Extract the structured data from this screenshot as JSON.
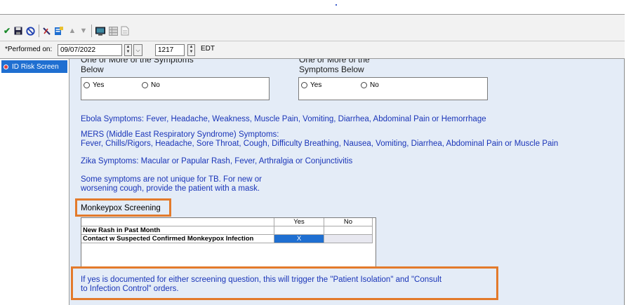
{
  "toolbar": {
    "icons": [
      "check-icon",
      "save-icon",
      "cancel-icon",
      "pen-icon",
      "form-icon",
      "up-arrow-icon",
      "down-arrow-icon",
      "monitor-icon",
      "grid-icon",
      "document-icon"
    ]
  },
  "performed": {
    "label": "*Performed on:",
    "date": "09/07/2022",
    "time": "1217",
    "timezone": "EDT"
  },
  "sidebar": {
    "items": [
      {
        "label": "ID Risk Screen"
      }
    ]
  },
  "form": {
    "q1": {
      "line1": "One or More of the Symptoms",
      "line2": "Below"
    },
    "q2": {
      "line1": "One or More of the",
      "line2": "Symptoms Below"
    },
    "yes": "Yes",
    "no": "No",
    "ebola": "Ebola Symptoms: Fever, Headache, Weakness, Muscle Pain, Vomiting, Diarrhea, Abdominal Pain or Hemorrhage",
    "mers_title": "MERS (Middle East Respiratory Syndrome) Symptoms:",
    "mers_body": "Fever, Chills/Rigors, Headache, Sore Throat, Cough, Difficulty Breathing, Nausea, Vomiting, Diarrhea, Abdominal Pain or Muscle Pain",
    "zika": "Zika Symptoms: Macular or Papular Rash, Fever, Arthralgia or Conjunctivitis",
    "tb_line1": "Some symptoms are not unique for TB.  For new or",
    "tb_line2": "worsening cough, provide the patient with a mask.",
    "monkeypox_label": "Monkeypox Screening",
    "grid": {
      "col_yes": "Yes",
      "col_no": "No",
      "rows": [
        {
          "question": "New Rash in Past Month",
          "yes": "",
          "no": ""
        },
        {
          "question": "Contact w Suspected Confirmed Monkeypox Infection",
          "yes": "X",
          "no": ""
        }
      ]
    },
    "note_line1": "If yes is documented for either screening question, this will trigger the \"Patient Isolation\" and \"Consult",
    "note_line2": "to Infection Control\" orders."
  }
}
